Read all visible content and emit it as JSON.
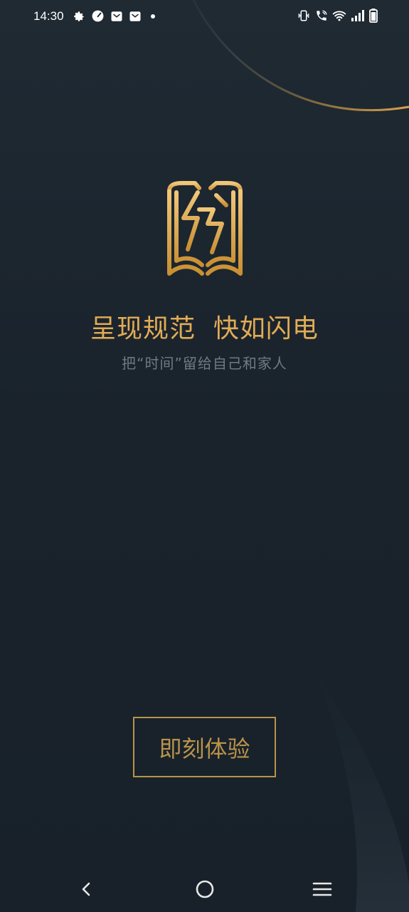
{
  "status_bar": {
    "time": "14:30",
    "left_icons": [
      "gear-icon",
      "speed-icon",
      "mail-icon",
      "mail-icon",
      "dot-icon"
    ],
    "right_icons": [
      "vibrate-icon",
      "wifi-call-icon",
      "wifi-icon",
      "signal-icon",
      "battery-icon"
    ]
  },
  "brand": {
    "logo_icon": "book-lightning-logo-icon",
    "headline": "呈现规范  快如闪电",
    "subline": "把“时间”留给自己和家人"
  },
  "cta": {
    "label": "即刻体验"
  },
  "nav": {
    "back_icon": "back-chevron-icon",
    "home_icon": "home-circle-icon",
    "menu_icon": "menu-lines-icon"
  },
  "colors": {
    "background": "#1c262f",
    "gold": "#e2ac55",
    "gold_muted": "#b8934a",
    "subtext": "#6f7a84"
  }
}
